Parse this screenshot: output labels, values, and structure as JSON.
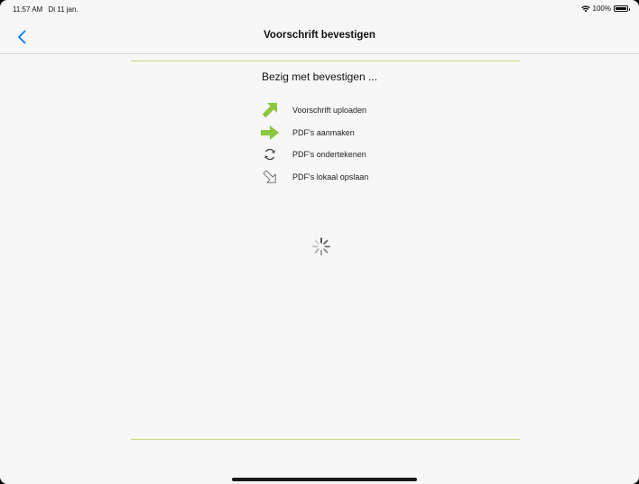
{
  "status_bar": {
    "time": "11:57 AM",
    "date": "Di 11 jan.",
    "battery": "100%",
    "wifi_icon": "wifi-icon",
    "battery_icon": "battery-full-icon"
  },
  "nav": {
    "back_icon": "chevron-left-icon",
    "title": "Voorschrift bevestigen"
  },
  "main": {
    "heading": "Bezig met bevestigen ...",
    "steps": [
      {
        "label": "Voorschrift uploaden",
        "icon": "arrow-up-right-icon",
        "state": "done"
      },
      {
        "label": "PDF's aanmaken",
        "icon": "arrow-right-icon",
        "state": "in-progress"
      },
      {
        "label": "PDF's ondertekenen",
        "icon": "sync-icon",
        "state": "pending"
      },
      {
        "label": "PDF's lokaal opslaan",
        "icon": "arrow-down-right-outline-icon",
        "state": "pending"
      }
    ],
    "spinner_icon": "activity-spinner-icon"
  },
  "colors": {
    "accent_green": "#8dc63f",
    "ios_blue": "#007aff",
    "rule_green": "#c5d97a",
    "background": "#f7f7f7"
  }
}
